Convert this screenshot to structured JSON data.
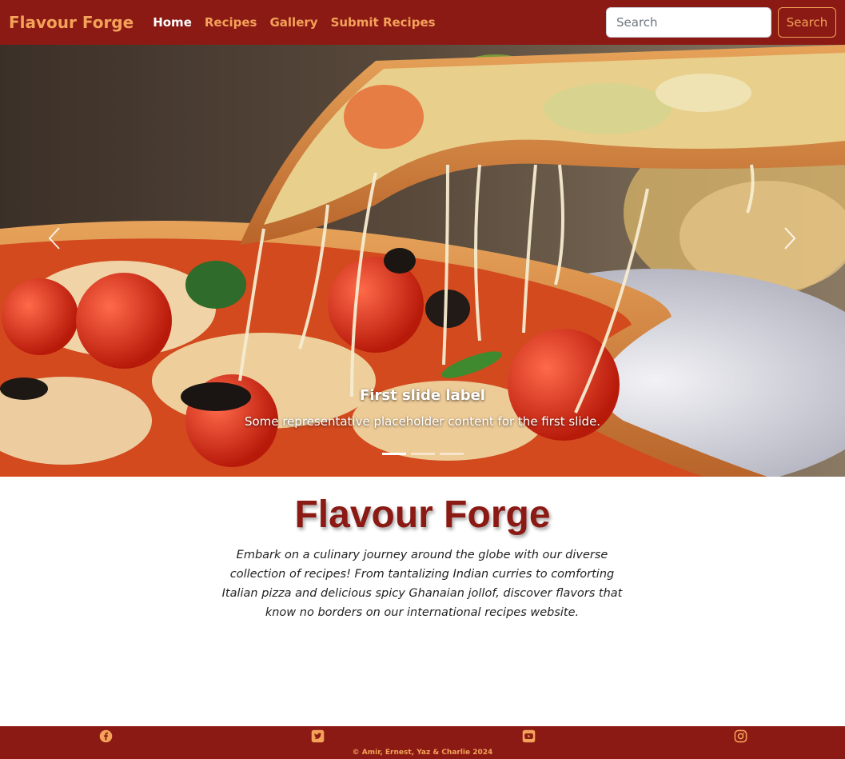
{
  "navbar": {
    "brand": "Flavour Forge",
    "links": [
      {
        "label": "Home",
        "active": true
      },
      {
        "label": "Recipes",
        "active": false
      },
      {
        "label": "Gallery",
        "active": false
      },
      {
        "label": "Submit Recipes",
        "active": false
      }
    ],
    "search": {
      "placeholder": "Search",
      "value": "",
      "button_label": "Search"
    }
  },
  "carousel": {
    "image": "pizza-slice-cheese-pull",
    "caption_title": "First slide label",
    "caption_text": "Some representative placeholder content for the first slide.",
    "slide_count": 3,
    "active_slide": 1,
    "prev_icon": "chevron-left-icon",
    "next_icon": "chevron-right-icon"
  },
  "hero": {
    "title": "Flavour Forge",
    "description": "Embark on a culinary journey around the globe with our diverse collection of recipes! From tantalizing Indian curries to comforting Italian pizza and delicious spicy Ghanaian jollof, discover flavors that know no borders on our international recipes website."
  },
  "footer": {
    "icons": [
      "facebook-icon",
      "twitter-icon",
      "youtube-icon",
      "instagram-icon"
    ],
    "copyright": "© Amir, Ernest, Yaz & Charlie 2024"
  },
  "colors": {
    "primary": "#8b1a14",
    "accent": "#f4a259",
    "white": "#ffffff"
  }
}
